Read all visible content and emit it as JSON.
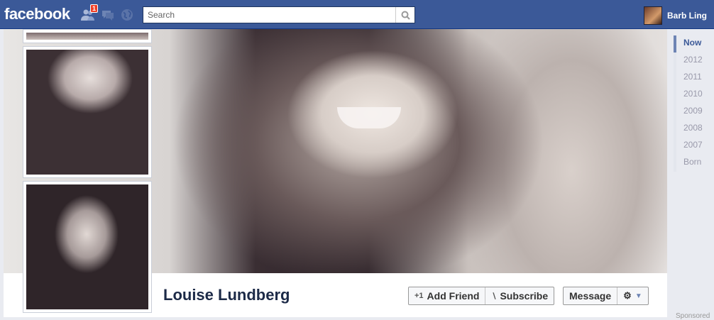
{
  "topbar": {
    "logo": "facebook",
    "friend_requests_count": "1",
    "search_placeholder": "Search",
    "user_name": "Barb Ling"
  },
  "profile": {
    "name": "Louise Lundberg"
  },
  "actions": {
    "add_friend": "Add Friend",
    "subscribe": "Subscribe",
    "message": "Message"
  },
  "timeline": {
    "items": [
      "Now",
      "2012",
      "2011",
      "2010",
      "2009",
      "2008",
      "2007",
      "Born"
    ]
  },
  "sidebar": {
    "sponsored": "Sponsored"
  },
  "colors": {
    "brand": "#3b5998",
    "badge": "#f03d25"
  }
}
